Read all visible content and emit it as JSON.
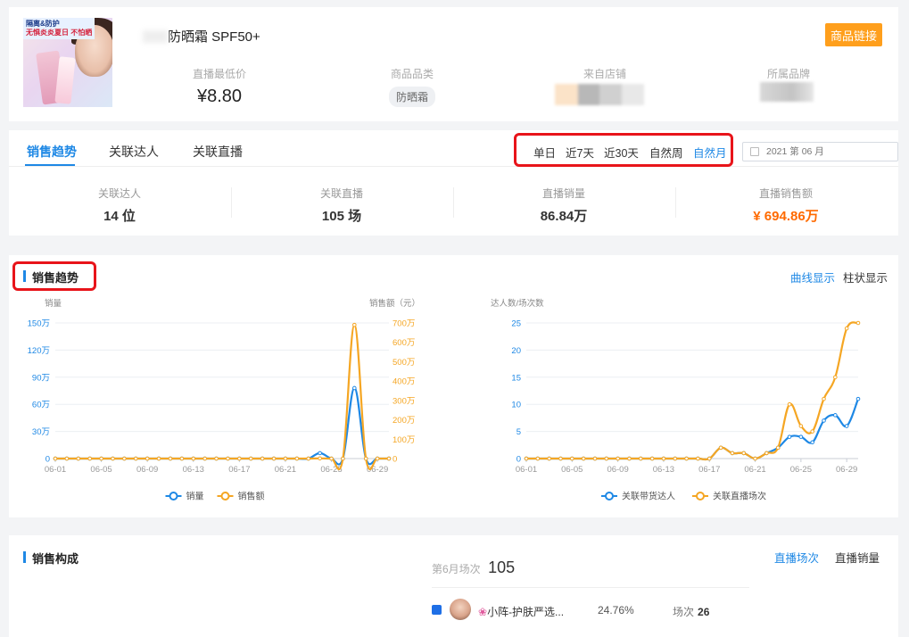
{
  "product": {
    "image_banner_line1": "隔离&防护",
    "image_banner_line2": "无惧炎炎夏日 不怕晒",
    "name_visible": "防晒霜 SPF50+",
    "link_button": "商品链接",
    "metrics": {
      "min_price_label": "直播最低价",
      "min_price_value": "¥8.80",
      "category_label": "商品品类",
      "category_value": "防晒霜",
      "shop_label": "来自店铺",
      "brand_label": "所属品牌"
    }
  },
  "tabs": {
    "items": [
      "销售趋势",
      "关联达人",
      "关联直播"
    ],
    "active": "销售趋势",
    "periods": [
      "单日",
      "近7天",
      "近30天",
      "自然周",
      "自然月"
    ],
    "active_period": "自然月",
    "date_picker_value": "2021 第 06 月"
  },
  "stats": [
    {
      "label": "关联达人",
      "value": "14 位"
    },
    {
      "label": "关联直播",
      "value": "105 场"
    },
    {
      "label": "直播销量",
      "value": "86.84万"
    },
    {
      "label": "直播销售额",
      "value": "¥ 694.86万"
    }
  ],
  "colors": {
    "accent_blue": "#1e88e5",
    "accent_orange": "#f5a623",
    "sales_orange": "#ff6a00",
    "highlight_red": "#e8141a",
    "button_orange": "#ff9f1c"
  },
  "trend": {
    "title": "销售趋势",
    "toggle_curve": "曲线显示",
    "toggle_bar": "柱状显示",
    "active_toggle": "曲线显示"
  },
  "chart_data": [
    {
      "type": "line",
      "x": [
        "06-01",
        "06-02",
        "06-03",
        "06-04",
        "06-05",
        "06-06",
        "06-07",
        "06-08",
        "06-09",
        "06-10",
        "06-11",
        "06-12",
        "06-13",
        "06-14",
        "06-15",
        "06-16",
        "06-17",
        "06-18",
        "06-19",
        "06-20",
        "06-21",
        "06-22",
        "06-23",
        "06-24",
        "06-25",
        "06-26",
        "06-27",
        "06-28",
        "06-29",
        "06-30"
      ],
      "xticks": [
        "06-01",
        "06-05",
        "06-09",
        "06-13",
        "06-17",
        "06-21",
        "06-25",
        "06-29"
      ],
      "ylabel_left": "销量",
      "ylabel_right": "销售额（元）",
      "yticks_left": [
        "0",
        "30万",
        "60万",
        "90万",
        "120万",
        "150万"
      ],
      "yticks_right": [
        "0",
        "100万",
        "200万",
        "300万",
        "400万",
        "500万",
        "600万",
        "700万"
      ],
      "ylim_left": [
        0,
        150
      ],
      "ylim_right": [
        0,
        700
      ],
      "series": [
        {
          "name": "销量",
          "axis": "left",
          "color": "#1e88e5",
          "values": [
            0,
            0,
            0,
            0,
            0,
            0,
            0,
            0,
            0,
            0,
            0,
            0,
            0,
            0,
            0,
            0,
            0,
            0,
            0,
            0,
            0,
            0,
            0,
            6,
            0,
            0,
            78,
            0,
            0,
            0
          ]
        },
        {
          "name": "销售额",
          "axis": "right",
          "color": "#f5a623",
          "values": [
            0,
            0,
            0,
            0,
            0,
            0,
            0,
            0,
            0,
            0,
            0,
            0,
            0,
            0,
            0,
            0,
            0,
            0,
            0,
            0,
            0,
            0,
            0,
            1,
            0,
            0,
            690,
            0,
            0,
            0
          ]
        }
      ],
      "legend": "bottom"
    },
    {
      "type": "line",
      "x": [
        "06-01",
        "06-02",
        "06-03",
        "06-04",
        "06-05",
        "06-06",
        "06-07",
        "06-08",
        "06-09",
        "06-10",
        "06-11",
        "06-12",
        "06-13",
        "06-14",
        "06-15",
        "06-16",
        "06-17",
        "06-18",
        "06-19",
        "06-20",
        "06-21",
        "06-22",
        "06-23",
        "06-24",
        "06-25",
        "06-26",
        "06-27",
        "06-28",
        "06-29",
        "06-30"
      ],
      "xticks": [
        "06-01",
        "06-05",
        "06-09",
        "06-13",
        "06-17",
        "06-21",
        "06-25",
        "06-29"
      ],
      "ylabel": "达人数/场次数",
      "yticks": [
        "0",
        "5",
        "10",
        "15",
        "20",
        "25"
      ],
      "ylim": [
        0,
        25
      ],
      "series": [
        {
          "name": "关联带货达人",
          "color": "#1e88e5",
          "values": [
            0,
            0,
            0,
            0,
            0,
            0,
            0,
            0,
            0,
            0,
            0,
            0,
            0,
            0,
            0,
            0,
            0,
            2,
            1,
            1,
            0,
            1,
            2,
            4,
            4,
            3,
            7,
            8,
            6,
            11
          ]
        },
        {
          "name": "关联直播场次",
          "color": "#f5a623",
          "values": [
            0,
            0,
            0,
            0,
            0,
            0,
            0,
            0,
            0,
            0,
            0,
            0,
            0,
            0,
            0,
            0,
            0,
            2,
            1,
            1,
            0,
            1,
            2,
            10,
            6,
            5,
            11,
            15,
            24,
            25
          ]
        }
      ],
      "legend": "bottom"
    }
  ],
  "composition": {
    "title": "销售构成",
    "tab_sessions": "直播场次",
    "tab_sales": "直播销量",
    "active_tab": "直播场次",
    "total_label": "第6月场次",
    "total_value": "105",
    "rows": [
      {
        "name": "小阵-护肤严选...",
        "share": "24.76%",
        "count_label": "场次",
        "count": "26"
      }
    ]
  }
}
